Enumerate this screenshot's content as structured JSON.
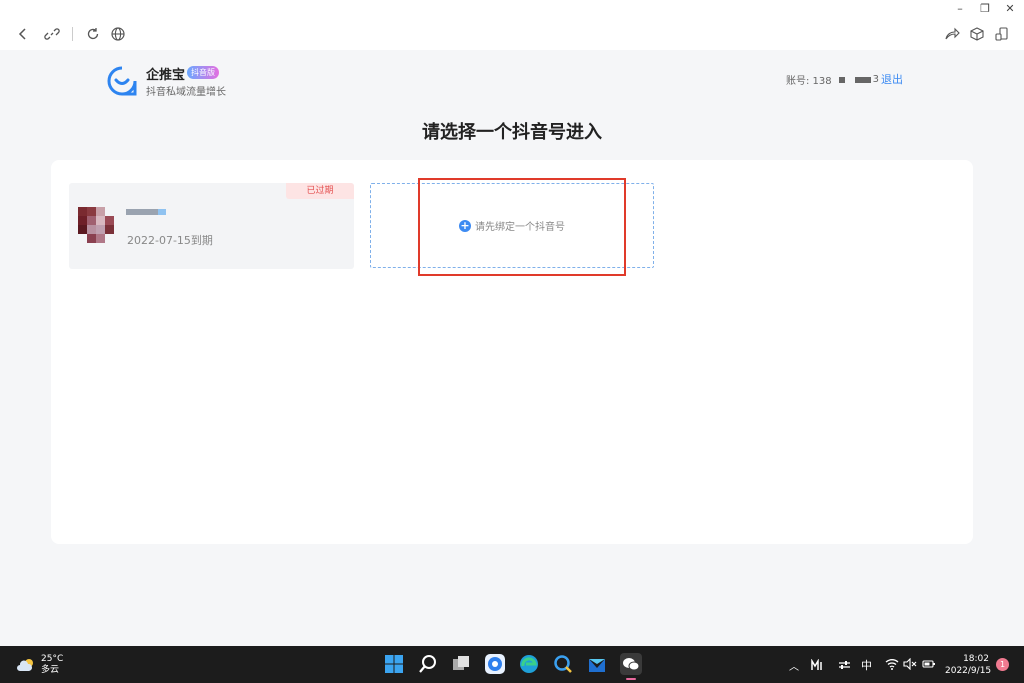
{
  "window": {
    "controls": {
      "minimize": "–",
      "restore": "❐",
      "close": "✕"
    }
  },
  "header": {
    "brand_name": "企推宝",
    "brand_badge": "抖音版",
    "brand_subtitle": "抖音私域流量增长",
    "account_prefix": "账号: 138",
    "account_suffix": "3",
    "logout_label": "退出"
  },
  "main": {
    "title": "请选择一个抖音号进入",
    "accounts": [
      {
        "status_tag": "已过期",
        "expiry": "2022-07-15到期"
      }
    ],
    "bind_label": "请先绑定一个抖音号"
  },
  "taskbar": {
    "weather_temp": "25°C",
    "weather_desc": "多云",
    "input_method": "中",
    "time": "18:02",
    "date": "2022/9/15",
    "notification_count": "1"
  },
  "colors": {
    "accent": "#3d8bf2",
    "expired": "#e45050",
    "highlight": "#e03a2a"
  }
}
